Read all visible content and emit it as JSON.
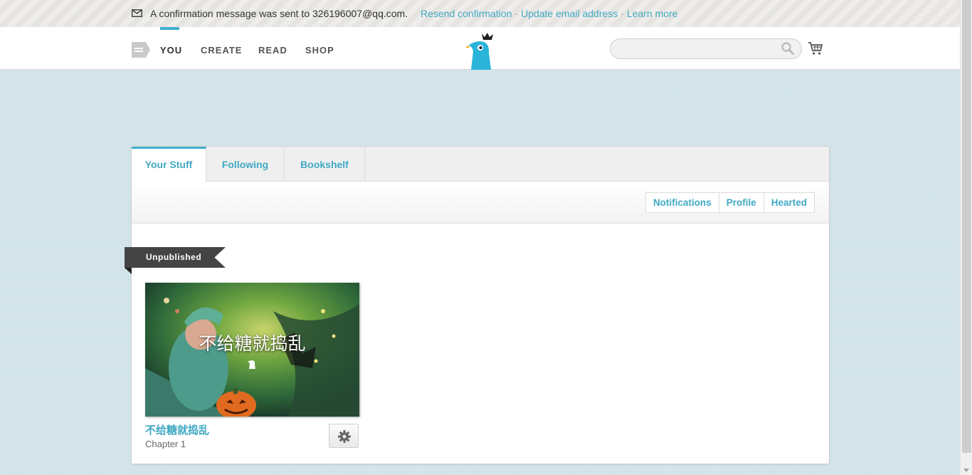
{
  "notice": {
    "message": "A confirmation message was sent to 326196007@qq.com.",
    "links": [
      {
        "label": "Resend confirmation"
      },
      {
        "label": "Update email address"
      },
      {
        "label": "Learn more"
      }
    ],
    "separator": "·"
  },
  "nav": {
    "items": [
      {
        "label": "YOU",
        "active": true
      },
      {
        "label": "CREATE"
      },
      {
        "label": "READ"
      },
      {
        "label": "SHOP"
      }
    ],
    "search": {
      "value": "",
      "placeholder": ""
    },
    "accent_color": "#41b0cf"
  },
  "tabs": [
    {
      "label": "Your Stuff",
      "active": true
    },
    {
      "label": "Following"
    },
    {
      "label": "Bookshelf"
    }
  ],
  "subtabs": [
    {
      "label": "Notifications"
    },
    {
      "label": "Profile"
    },
    {
      "label": "Hearted"
    }
  ],
  "section": {
    "ribbon_label": "Unpublished"
  },
  "story": {
    "cover_title": "不给糖就捣乱",
    "title": "不给糖就捣乱",
    "subtitle": "Chapter 1"
  },
  "icons": {
    "mail": "mail-icon",
    "menu": "menu-icon",
    "logo": "bird-logo-icon",
    "search": "search-icon",
    "cart": "cart-icon",
    "settings": "gear-icon"
  }
}
